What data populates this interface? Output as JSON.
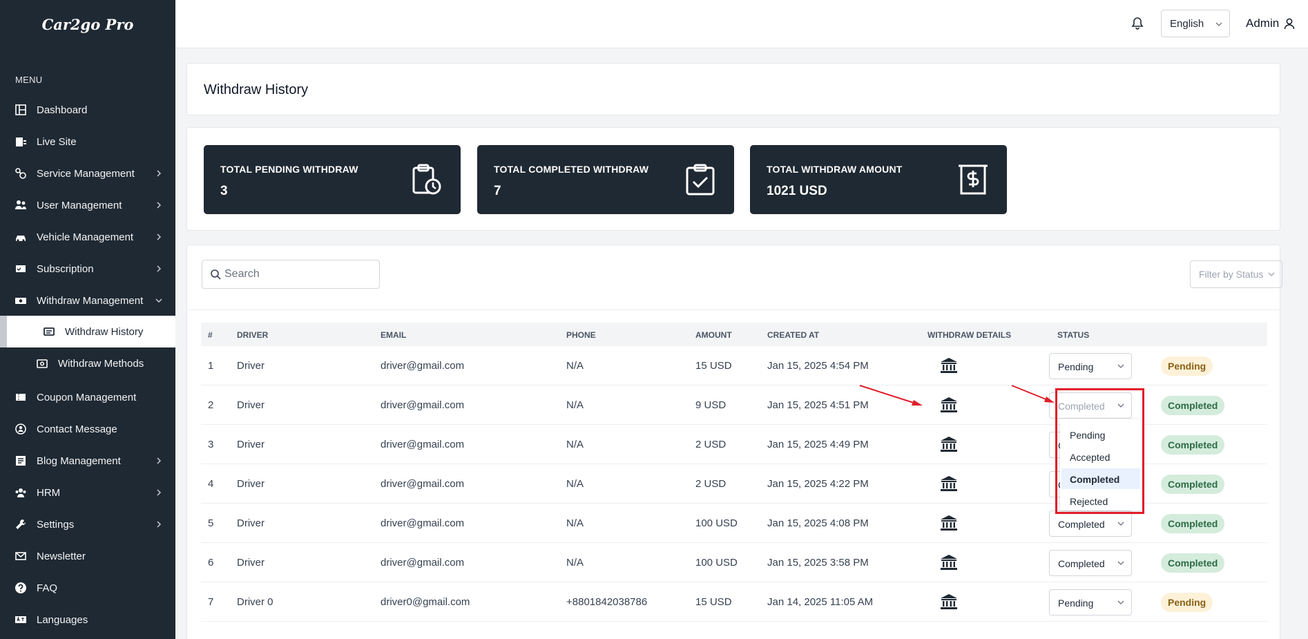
{
  "app": {
    "logo": "Car2go Pro"
  },
  "sidebar": {
    "menu_label": "MENU",
    "items": [
      {
        "label": "Dashboard",
        "icon": "dashboard-icon"
      },
      {
        "label": "Live Site",
        "icon": "live-site-icon"
      },
      {
        "label": "Service Management",
        "icon": "service-icon",
        "expandable": true
      },
      {
        "label": "User Management",
        "icon": "users-icon",
        "expandable": true
      },
      {
        "label": "Vehicle Management",
        "icon": "car-icon",
        "expandable": true
      },
      {
        "label": "Subscription",
        "icon": "subscription-icon",
        "expandable": true
      },
      {
        "label": "Withdraw Management",
        "icon": "money-icon",
        "expandable": true,
        "expanded": true
      },
      {
        "label": "Withdraw History",
        "icon": "list-icon",
        "sub": true,
        "active": true
      },
      {
        "label": "Withdraw Methods",
        "icon": "wallet-icon",
        "sub": true
      },
      {
        "label": "Coupon Management",
        "icon": "coupon-icon"
      },
      {
        "label": "Contact Message",
        "icon": "contact-icon"
      },
      {
        "label": "Blog Management",
        "icon": "blog-icon",
        "expandable": true
      },
      {
        "label": "HRM",
        "icon": "hrm-icon",
        "expandable": true
      },
      {
        "label": "Settings",
        "icon": "wrench-icon",
        "expandable": true
      },
      {
        "label": "Newsletter",
        "icon": "mail-icon"
      },
      {
        "label": "FAQ",
        "icon": "question-icon"
      },
      {
        "label": "Languages",
        "icon": "language-icon"
      }
    ]
  },
  "header": {
    "language": "English",
    "user": "Admin"
  },
  "page": {
    "title": "Withdraw History"
  },
  "stats": [
    {
      "label": "TOTAL PENDING WITHDRAW",
      "value": "3",
      "icon": "clipboard-clock-icon"
    },
    {
      "label": "TOTAL COMPLETED WITHDRAW",
      "value": "7",
      "icon": "clipboard-check-icon"
    },
    {
      "label": "TOTAL WITHDRAW AMOUNT",
      "value": "1021 USD",
      "icon": "dollar-receipt-icon"
    }
  ],
  "search": {
    "placeholder": "Search"
  },
  "filter": {
    "label": "Filter by Status"
  },
  "table": {
    "headers": [
      "#",
      "DRIVER",
      "EMAIL",
      "PHONE",
      "AMOUNT",
      "CREATED AT",
      "WITHDRAW DETAILS",
      "STATUS"
    ],
    "rows": [
      {
        "n": "1",
        "driver": "Driver",
        "email": "driver@gmail.com",
        "phone": "N/A",
        "amount": "15 USD",
        "created": "Jan 15, 2025 4:54 PM",
        "select": "Pending",
        "badge": "Pending"
      },
      {
        "n": "2",
        "driver": "Driver",
        "email": "driver@gmail.com",
        "phone": "N/A",
        "amount": "9 USD",
        "created": "Jan 15, 2025 4:51 PM",
        "select": "Completed",
        "badge": "Completed"
      },
      {
        "n": "3",
        "driver": "Driver",
        "email": "driver@gmail.com",
        "phone": "N/A",
        "amount": "2 USD",
        "created": "Jan 15, 2025 4:49 PM",
        "select": "Completed",
        "badge": "Completed"
      },
      {
        "n": "4",
        "driver": "Driver",
        "email": "driver@gmail.com",
        "phone": "N/A",
        "amount": "2 USD",
        "created": "Jan 15, 2025 4:22 PM",
        "select": "Completed",
        "badge": "Completed"
      },
      {
        "n": "5",
        "driver": "Driver",
        "email": "driver@gmail.com",
        "phone": "N/A",
        "amount": "100 USD",
        "created": "Jan 15, 2025 4:08 PM",
        "select": "Completed",
        "badge": "Completed"
      },
      {
        "n": "6",
        "driver": "Driver",
        "email": "driver@gmail.com",
        "phone": "N/A",
        "amount": "100 USD",
        "created": "Jan 15, 2025 3:58 PM",
        "select": "Completed",
        "badge": "Completed"
      },
      {
        "n": "7",
        "driver": "Driver 0",
        "email": "driver0@gmail.com",
        "phone": "+8801842038786",
        "amount": "15 USD",
        "created": "Jan 14, 2025 11:05 AM",
        "select": "Pending",
        "badge": "Pending"
      }
    ]
  },
  "status_dropdown": {
    "options": [
      "Pending",
      "Accepted",
      "Completed",
      "Rejected"
    ],
    "selected": "Completed"
  },
  "colors": {
    "sidebar": "#1f2933",
    "highlight": "#e11d2a",
    "pending_bg": "#fdf1d8",
    "completed_bg": "#d4ecdc"
  }
}
